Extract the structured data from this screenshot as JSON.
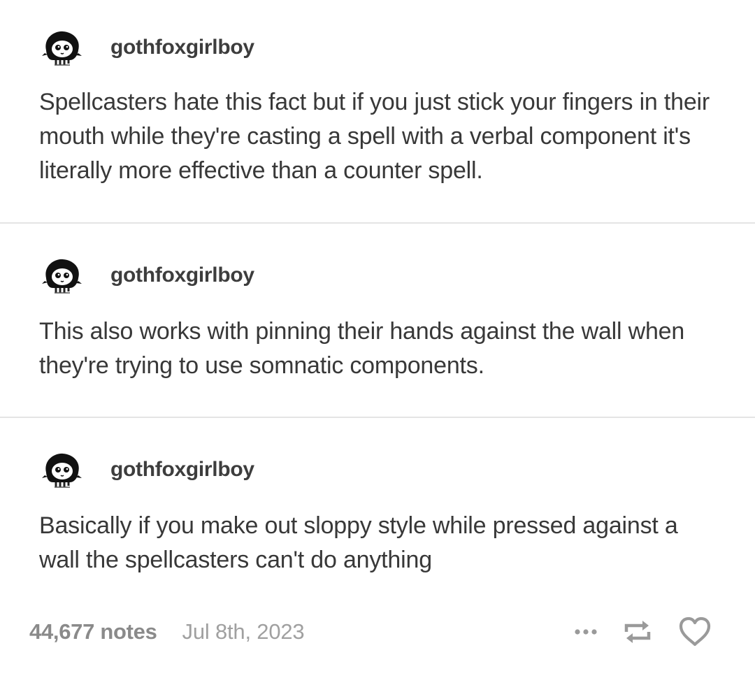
{
  "posts": [
    {
      "username": "gothfoxgirlboy",
      "avatar_icon": "goth-character-avatar-icon",
      "body": "Spellcasters hate this fact but if you just stick your fingers in their mouth while they're casting a spell with a verbal component it's literally more effective than a counter spell."
    },
    {
      "username": "gothfoxgirlboy",
      "avatar_icon": "goth-character-avatar-icon",
      "body": "This also works with pinning their hands against the wall when they're trying to use somnatic components."
    },
    {
      "username": "gothfoxgirlboy",
      "avatar_icon": "goth-character-avatar-icon",
      "body": "Basically if you make out sloppy style while pressed against a wall the spellcasters can't do anything"
    }
  ],
  "footer": {
    "notes": "44,677 notes",
    "date": "Jul 8th, 2023",
    "actions": [
      "more-icon",
      "reblog-icon",
      "heart-icon"
    ]
  },
  "colors": {
    "text": "#383838",
    "muted": "#8a8a8a",
    "divider": "#e4e4e4",
    "icon": "#9a9a9a"
  }
}
